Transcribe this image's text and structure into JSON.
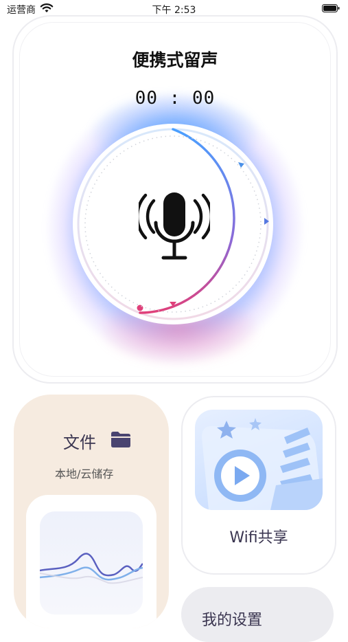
{
  "status_bar": {
    "carrier": "运营商",
    "time": "下午 2:53"
  },
  "recorder": {
    "title": "便携式留声",
    "timer": "00 : 00",
    "mic_icon": "microphone-icon",
    "progress_gradient": [
      "#4aa0ff",
      "#9b6bd6",
      "#e0407a"
    ]
  },
  "files": {
    "title": "文件",
    "subtitle": "本地/云储存",
    "icon": "folder-icon"
  },
  "wifi_share": {
    "label": "Wifi共享"
  },
  "settings": {
    "label": "我的设置"
  },
  "colors": {
    "accent_text": "#3a3550",
    "files_bg": "#f6ebe0",
    "folder": "#4a4470"
  }
}
